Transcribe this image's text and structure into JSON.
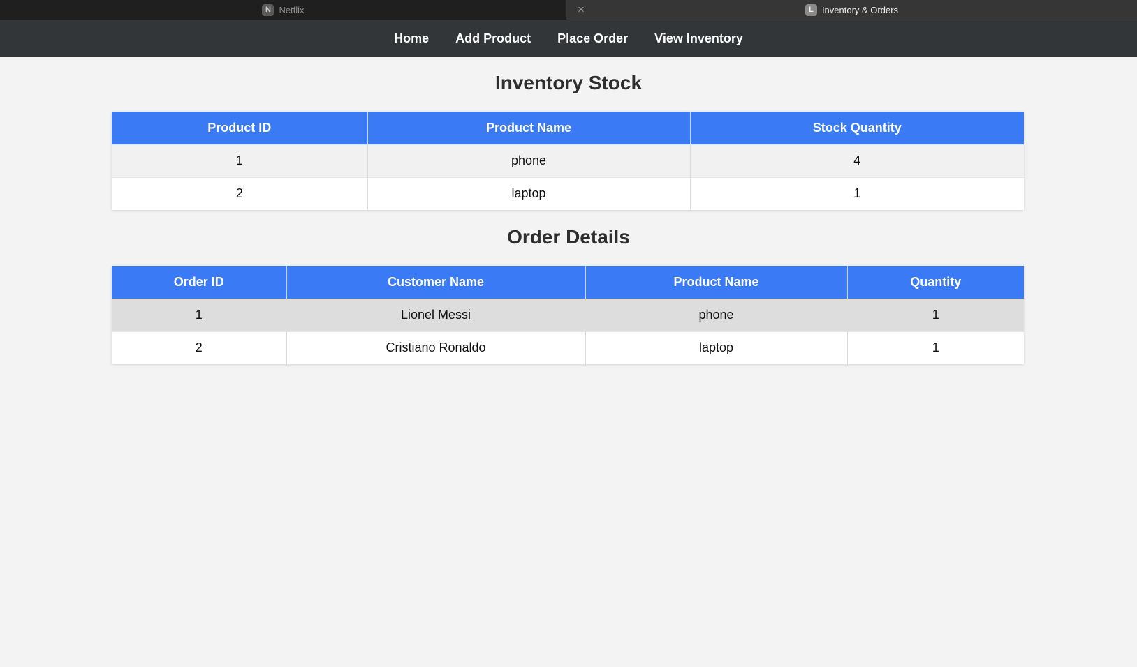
{
  "browser": {
    "tabs": [
      {
        "favicon": "N",
        "title": "Netflix"
      },
      {
        "favicon": "L",
        "title": "Inventory & Orders"
      }
    ],
    "close_icon": "×"
  },
  "nav": {
    "links": [
      "Home",
      "Add Product",
      "Place Order",
      "View Inventory"
    ]
  },
  "inventory": {
    "heading": "Inventory Stock",
    "columns": [
      "Product ID",
      "Product Name",
      "Stock Quantity"
    ],
    "rows": [
      [
        "1",
        "phone",
        "4"
      ],
      [
        "2",
        "laptop",
        "1"
      ]
    ]
  },
  "orders": {
    "heading": "Order Details",
    "columns": [
      "Order ID",
      "Customer Name",
      "Product Name",
      "Quantity"
    ],
    "rows": [
      [
        "1",
        "Lionel Messi",
        "phone",
        "1"
      ],
      [
        "2",
        "Cristiano Ronaldo",
        "laptop",
        "1"
      ]
    ]
  },
  "colors": {
    "header_blue": "#3a7bf5",
    "nav_bg": "#333638",
    "page_bg": "#f3f3f3"
  }
}
